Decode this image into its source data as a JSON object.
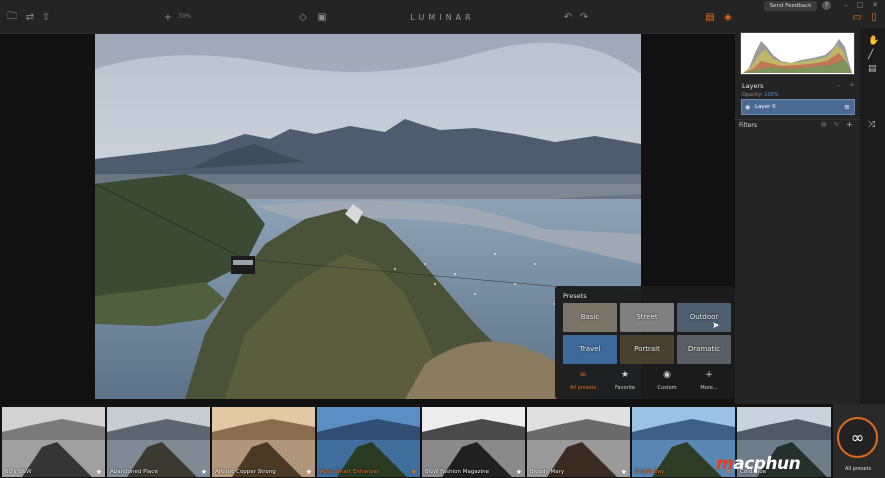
{
  "window": {
    "app_title": "LUMINAR",
    "zoom": "70%",
    "feedback_label": "Send Feedback",
    "help_label": "?"
  },
  "right_panel": {
    "layers_title": "Layers",
    "opacity_label": "Opacity:",
    "opacity_value": "100%",
    "layer_name": "Layer 0",
    "filters_label": "Filters"
  },
  "presets_popup": {
    "title": "Presets",
    "categories": [
      {
        "label": "Basic",
        "color": "#7a7568"
      },
      {
        "label": "Street",
        "color": "#808080"
      },
      {
        "label": "Outdoor",
        "color": "#4e5f70"
      },
      {
        "label": "Travel",
        "color": "#3d6a9a"
      },
      {
        "label": "Portrait",
        "color": "#4a4030"
      },
      {
        "label": "Dramatic",
        "color": "#5a5f66"
      }
    ],
    "nav": [
      {
        "label": "All presets",
        "icon": "infinity-icon",
        "active": true
      },
      {
        "label": "Favorite",
        "icon": "star-icon",
        "active": false
      },
      {
        "label": "Custom",
        "icon": "user-icon",
        "active": false
      },
      {
        "label": "More...",
        "icon": "plus-icon",
        "active": false
      }
    ]
  },
  "filmstrip": [
    {
      "label": "60's B&W",
      "mono": true,
      "active": false,
      "favorite": false
    },
    {
      "label": "Abandoned Place",
      "mono": false,
      "active": false,
      "favorite": false
    },
    {
      "label": "Artistic Copper Strong",
      "mono": false,
      "active": false,
      "favorite": false
    },
    {
      "label": "Auto Smart Enhancer",
      "mono": false,
      "active": true,
      "favorite": true
    },
    {
      "label": "B&W Fashion Magazine",
      "mono": true,
      "active": false,
      "favorite": false
    },
    {
      "label": "Bloody Mary",
      "mono": false,
      "active": false,
      "favorite": false
    },
    {
      "label": "Bright Day",
      "mono": false,
      "active": true,
      "favorite": true
    },
    {
      "label": "Cold Blue",
      "mono": false,
      "active": false,
      "favorite": false
    }
  ],
  "all_presets_label": "All presets",
  "brand": {
    "prefix": "m",
    "rest": "acphun"
  },
  "colors": {
    "accent": "#e06b1a",
    "layer_selected": "#4a6a93"
  }
}
